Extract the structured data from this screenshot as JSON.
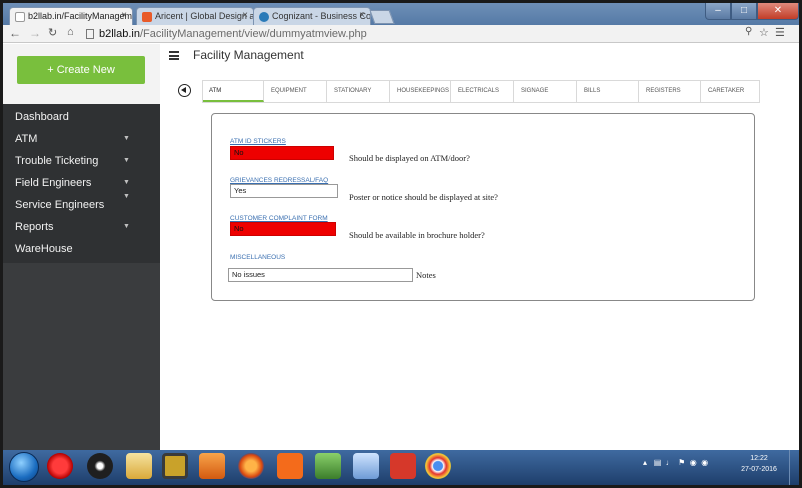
{
  "browser": {
    "tabs": [
      {
        "label": "b2llab.in/FacilityManagem",
        "active": true,
        "favicon_color": "#ffffff"
      },
      {
        "label": "Aricent | Global Design a",
        "active": false,
        "favicon_color": "#e85b2a"
      },
      {
        "label": "Cognizant - Business Con",
        "active": false,
        "favicon_color": "#2a7ab8"
      }
    ],
    "tab_close_glyph": "×",
    "url_domain": "b2llab.in",
    "url_path": "/FacilityManagement/view/dummyatmview.php",
    "nav_icons": [
      "back-arrow-icon",
      "forward-arrow-icon",
      "reload-icon",
      "home-icon"
    ]
  },
  "sidebar": {
    "create_label": "+   Create New",
    "items": [
      {
        "label": "Dashboard",
        "has_caret": false
      },
      {
        "label": "ATM",
        "has_caret": true
      },
      {
        "label": "Trouble Ticketing",
        "has_caret": true
      },
      {
        "label": "Field Engineers",
        "has_caret": true
      },
      {
        "label": "Service Engineers",
        "has_caret": true
      },
      {
        "label": "Reports",
        "has_caret": true
      },
      {
        "label": "WareHouse",
        "has_caret": false
      }
    ]
  },
  "header": {
    "title": "Facility Management"
  },
  "subtabs": [
    "ATM",
    "EQUIPMENT",
    "STATIONARY",
    "HOUSEKEEPINGS",
    "ELECTRICALS",
    "SIGNAGE",
    "BILLS",
    "REGISTERS",
    "CARETAKER"
  ],
  "active_subtab": "ATM",
  "form": {
    "fields": [
      {
        "label": "ATM ID STICKERS",
        "value": "No",
        "note": "Should be displayed on ATM/door?",
        "highlight": "#ee0000"
      },
      {
        "label": "GRIEVANCES REDRESSAL/FAQ",
        "value": "Yes",
        "note": "Poster or notice should be displayed at site?",
        "highlight": ""
      },
      {
        "label": "CUSTOMER COMPLAINT FORM",
        "value": "No",
        "note": "Should be available in brochure holder?",
        "highlight": "#ee0000"
      },
      {
        "label": "MISCELLANEOUS",
        "value": "No issues",
        "note": "Notes",
        "highlight": ""
      }
    ]
  },
  "taskbar": {
    "clock_time": "12:22",
    "clock_date": "27-07-2016"
  },
  "colors": {
    "accent_green": "#79bf3d",
    "sidebar_bg": "#2f3133",
    "link_blue": "#3a6fb0"
  }
}
